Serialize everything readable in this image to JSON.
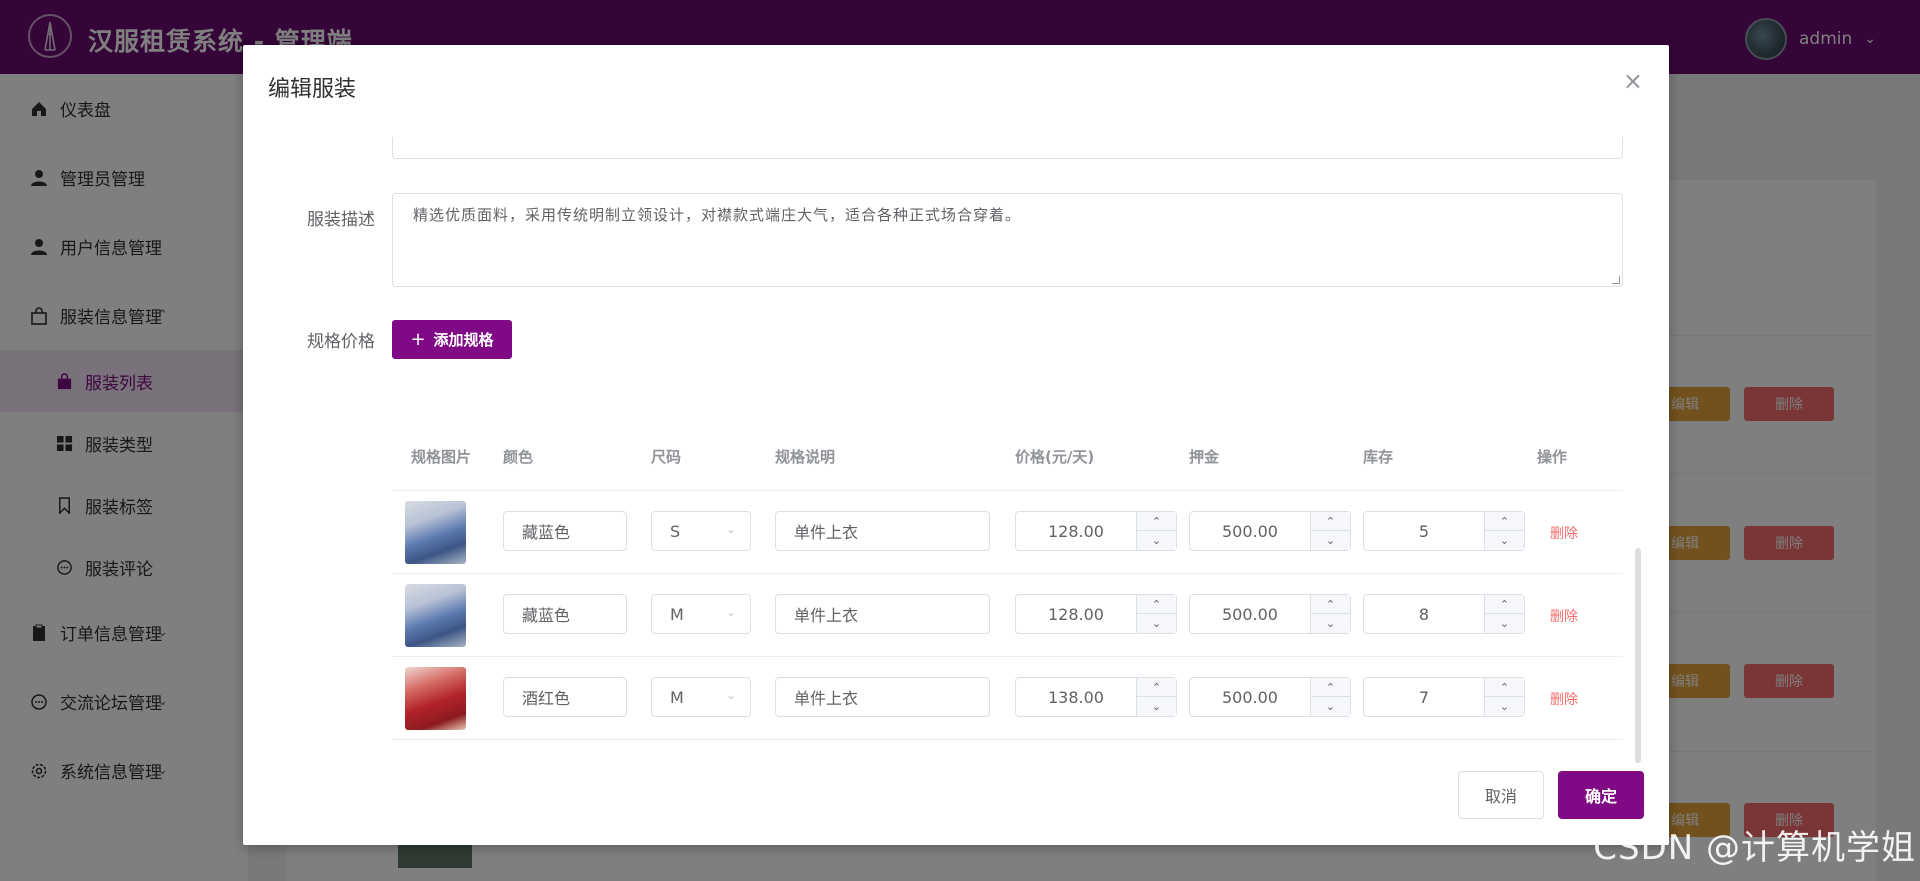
{
  "header": {
    "title": "汉服租赁系统 - 管理端",
    "user": "admin"
  },
  "sidebar": {
    "items": [
      {
        "label": "仪表盘",
        "icon": "home-icon"
      },
      {
        "label": "管理员管理",
        "icon": "user-icon"
      },
      {
        "label": "用户信息管理",
        "icon": "user-icon"
      },
      {
        "label": "服装信息管理",
        "icon": "bag-icon",
        "expanded": true,
        "children": [
          {
            "label": "服装列表",
            "icon": "bag-icon",
            "active": true
          },
          {
            "label": "服装类型",
            "icon": "grid-icon"
          },
          {
            "label": "服装标签",
            "icon": "bookmark-icon"
          },
          {
            "label": "服装评论",
            "icon": "chat-icon"
          }
        ]
      },
      {
        "label": "订单信息管理",
        "icon": "clipboard-icon"
      },
      {
        "label": "交流论坛管理",
        "icon": "chat-icon"
      },
      {
        "label": "系统信息管理",
        "icon": "gear-icon"
      }
    ]
  },
  "background": {
    "edit_label": "编辑",
    "delete_label": "删除"
  },
  "dialog": {
    "title": "编辑服装",
    "desc_label": "服装描述",
    "desc_value": "精选优质面料，采用传统明制立领设计，对襟款式端庄大气，适合各种正式场合穿着。",
    "spec_label": "规格价格",
    "add_spec": "添加规格",
    "columns": [
      "规格图片",
      "颜色",
      "尺码",
      "规格说明",
      "价格(元/天)",
      "押金",
      "库存",
      "操作"
    ],
    "rows": [
      {
        "image": "blue",
        "color": "藏蓝色",
        "size": "S",
        "note": "单件上衣",
        "price": "128.00",
        "deposit": "500.00",
        "stock": "5",
        "action": "删除"
      },
      {
        "image": "blue",
        "color": "藏蓝色",
        "size": "M",
        "note": "单件上衣",
        "price": "128.00",
        "deposit": "500.00",
        "stock": "8",
        "action": "删除"
      },
      {
        "image": "red",
        "color": "酒红色",
        "size": "M",
        "note": "单件上衣",
        "price": "138.00",
        "deposit": "500.00",
        "stock": "7",
        "action": "删除"
      }
    ],
    "cancel": "取消",
    "confirm": "确定"
  },
  "watermark": "CSDN @计算机学姐",
  "colors": {
    "brand": "#800a86",
    "danger": "#f56c6c",
    "warning": "#e6a23c"
  }
}
